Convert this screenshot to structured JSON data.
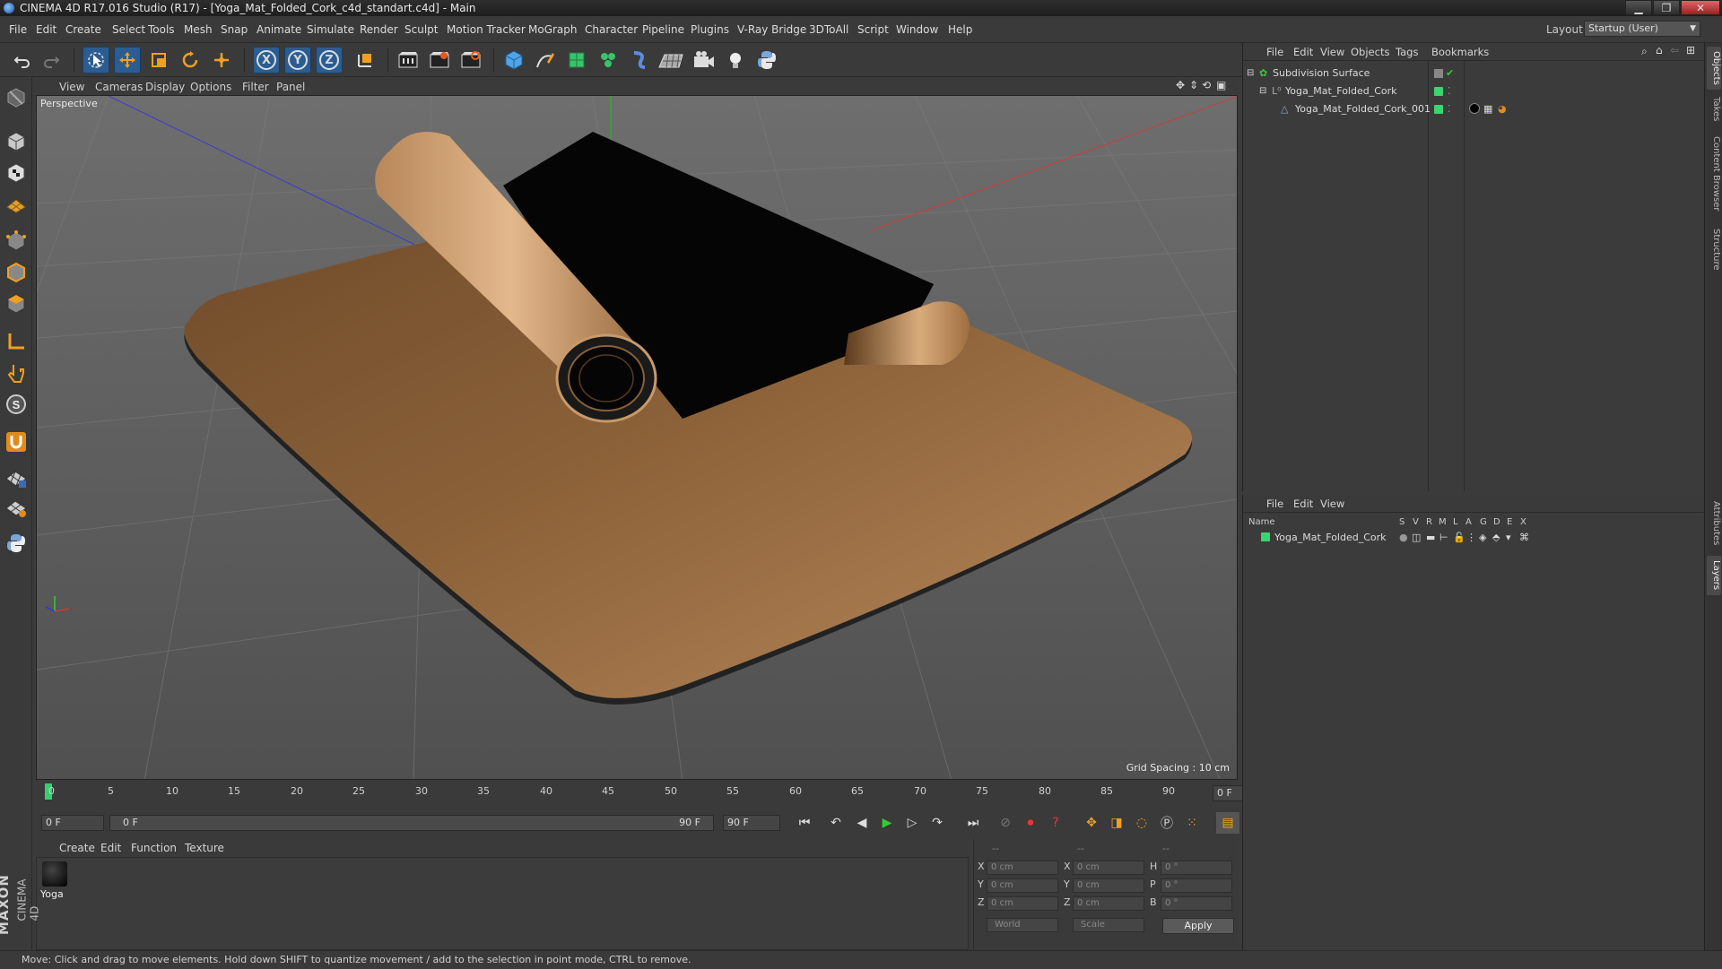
{
  "window": {
    "title": "CINEMA 4D R17.016 Studio (R17) - [Yoga_Mat_Folded_Cork_c4d_standart.c4d] - Main",
    "minimize": "▁",
    "maximize": "❐",
    "close": "✕"
  },
  "menubar": {
    "items": [
      "File",
      "Edit",
      "Create",
      "Select",
      "Tools",
      "Mesh",
      "Snap",
      "Animate",
      "Simulate",
      "Render",
      "Sculpt",
      "Motion Tracker",
      "MoGraph",
      "Character",
      "Pipeline",
      "Plugins",
      "V-Ray Bridge",
      "3DToAll",
      "Script",
      "Window",
      "Help"
    ],
    "layout_label": "Layout:",
    "layout_value": "Startup (User)"
  },
  "toolbar": {
    "icons": [
      "undo-icon",
      "redo-icon",
      "live-selection-icon",
      "move-icon",
      "scale-icon",
      "rotate-icon",
      "transform-icon",
      "x-axis-lock-icon",
      "y-axis-lock-icon",
      "z-axis-lock-icon",
      "coordinate-system-icon",
      "render-view-icon",
      "render-picture-viewer-icon",
      "edit-render-settings-icon",
      "cube-icon",
      "pen-spline-icon",
      "subdivision-icon",
      "cloner-icon",
      "deformer-icon",
      "floor-icon",
      "camera-icon",
      "light-icon",
      "python-icon"
    ],
    "axis_labels": [
      "X",
      "Y",
      "Z"
    ]
  },
  "viewport": {
    "menu": [
      "View",
      "Cameras",
      "Display",
      "Options",
      "Filter",
      "Panel"
    ],
    "camera_label": "Perspective",
    "grid_spacing": "Grid Spacing : 10 cm"
  },
  "timeline": {
    "ticks": [
      "0",
      "5",
      "10",
      "15",
      "20",
      "25",
      "30",
      "35",
      "40",
      "45",
      "50",
      "55",
      "60",
      "65",
      "70",
      "75",
      "80",
      "85",
      "90"
    ],
    "current_frame": "0 F"
  },
  "transport": {
    "start_field": "0 F",
    "range_start": "0 F",
    "range_end": "90 F",
    "end_field": "90 F"
  },
  "material_manager": {
    "menu": [
      "Create",
      "Edit",
      "Function",
      "Texture"
    ],
    "materials": [
      {
        "name": "Yoga"
      }
    ]
  },
  "coordinates": {
    "header_dashes": [
      "--",
      "--",
      "--"
    ],
    "rows": [
      {
        "axis": "X",
        "pos": "0 cm",
        "size_axis": "X",
        "size": "0 cm",
        "rot_axis": "H",
        "rot": "0 °"
      },
      {
        "axis": "Y",
        "pos": "0 cm",
        "size_axis": "Y",
        "size": "0 cm",
        "rot_axis": "P",
        "rot": "0 °"
      },
      {
        "axis": "Z",
        "pos": "0 cm",
        "size_axis": "Z",
        "size": "0 cm",
        "rot_axis": "B",
        "rot": "0 °"
      }
    ],
    "mode_select": "World",
    "scale_select": "Scale",
    "apply": "Apply"
  },
  "object_manager": {
    "menu": [
      "File",
      "Edit",
      "View",
      "Objects",
      "Tags",
      "Bookmarks"
    ],
    "objects": [
      {
        "name": "Subdivision Surface",
        "indent": 0
      },
      {
        "name": "Yoga_Mat_Folded_Cork",
        "indent": 1
      },
      {
        "name": "Yoga_Mat_Folded_Cork_001",
        "indent": 2
      }
    ]
  },
  "layer_manager": {
    "menu": [
      "File",
      "Edit",
      "View"
    ],
    "columns": [
      "Name",
      "S",
      "V",
      "R",
      "M",
      "L",
      "A",
      "G",
      "D",
      "E",
      "X"
    ],
    "layers": [
      {
        "name": "Yoga_Mat_Folded_Cork"
      }
    ]
  },
  "side_tabs": [
    "Objects",
    "Takes",
    "Content Browser",
    "Structure",
    "Attributes",
    "Layers"
  ],
  "statusbar": {
    "text": "Move: Click and drag to move elements. Hold down SHIFT to quantize movement / add to the selection in point mode, CTRL to remove."
  },
  "colors": {
    "accent": "#2b5d92",
    "object_green": "#3dd36e",
    "cork": "#b8875a"
  }
}
